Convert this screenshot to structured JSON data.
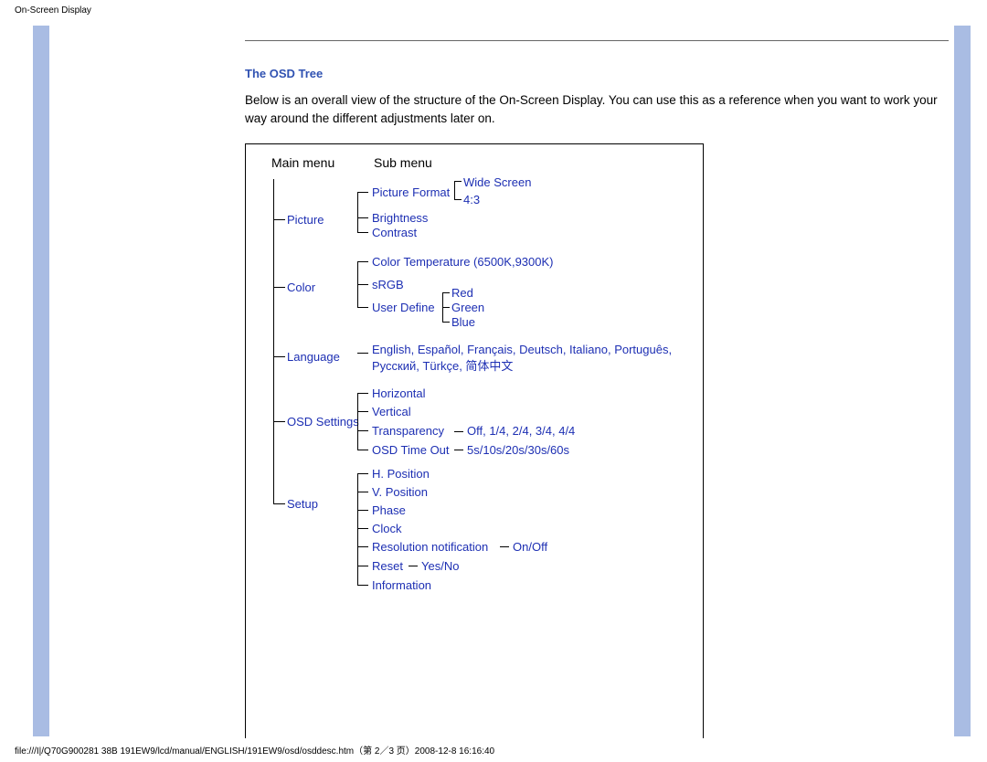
{
  "header": "On-Screen Display",
  "footer": "file:///I|/Q70G900281 38B 191EW9/lcd/manual/ENGLISH/191EW9/osd/osddesc.htm（第 2／3 页）2008-12-8 16:16:40",
  "section_title": "The OSD Tree",
  "body_text": "Below is an overall view of the structure of the On-Screen Display. You can use this as a reference when you want to work your way around the different adjustments later on.",
  "cols": {
    "main": "Main menu",
    "sub": "Sub menu"
  },
  "tree": {
    "picture": {
      "label": "Picture",
      "picture_format": {
        "label": "Picture Format",
        "wide": "Wide Screen",
        "ratio": "4:3"
      },
      "brightness": "Brightness",
      "contrast": "Contrast"
    },
    "color": {
      "label": "Color",
      "color_temp": "Color Temperature (6500K,9300K)",
      "srgb": "sRGB",
      "user_define": {
        "label": "User Define",
        "red": "Red",
        "green": "Green",
        "blue": "Blue"
      }
    },
    "language": {
      "label": "Language",
      "langs": "English, Español, Français, Deutsch, Italiano, Português, Русский, Türkçe, 简体中文"
    },
    "osd_settings": {
      "label": "OSD Settings",
      "horizontal": "Horizontal",
      "vertical": "Vertical",
      "transparency": {
        "label": "Transparency",
        "values": "Off, 1/4, 2/4, 3/4, 4/4"
      },
      "osd_timeout": {
        "label": "OSD Time Out",
        "values": "5s/10s/20s/30s/60s"
      }
    },
    "setup": {
      "label": "Setup",
      "h_position": "H. Position",
      "v_position": "V. Position",
      "phase": "Phase",
      "clock": "Clock",
      "resolution_notification": {
        "label": "Resolution notification",
        "values": "On/Off"
      },
      "reset": {
        "label": "Reset",
        "values": "Yes/No"
      },
      "information": "Information"
    }
  }
}
